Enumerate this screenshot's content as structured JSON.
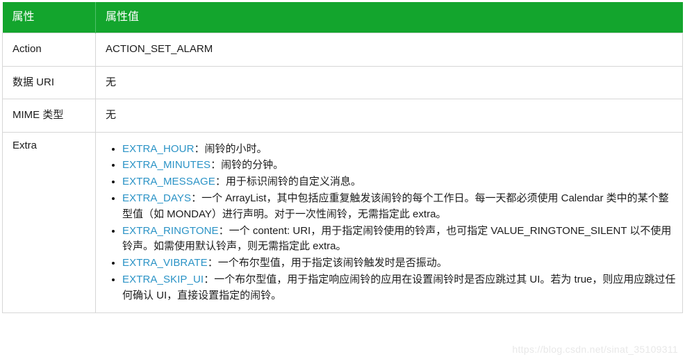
{
  "table": {
    "headers": [
      "属性",
      "属性值"
    ],
    "header_bg": "#13a52d",
    "link_color": "#2b93c6",
    "border_color": "#d6d6d6",
    "rows": [
      {
        "attr": "Action",
        "value": "ACTION_SET_ALARM"
      },
      {
        "attr": "数据 URI",
        "value": "无"
      },
      {
        "attr": "MIME 类型",
        "value": "无"
      }
    ],
    "extra_row": {
      "attr": "Extra",
      "items": [
        {
          "term": "EXTRA_HOUR",
          "text": "：闹铃的小时。"
        },
        {
          "term": "EXTRA_MINUTES",
          "text": "：闹铃的分钟。"
        },
        {
          "term": "EXTRA_MESSAGE",
          "text": "：用于标识闹铃的自定义消息。"
        },
        {
          "term": "EXTRA_DAYS",
          "text": "：一个 ArrayList，其中包括应重复触发该闹铃的每个工作日。每一天都必须使用 Calendar 类中的某个整型值（如 MONDAY）进行声明。对于一次性闹铃，无需指定此 extra。"
        },
        {
          "term": "EXTRA_RINGTONE",
          "text": "：一个 content: URI，用于指定闹铃使用的铃声，也可指定 VALUE_RINGTONE_SILENT 以不使用铃声。如需使用默认铃声，则无需指定此 extra。"
        },
        {
          "term": "EXTRA_VIBRATE",
          "text": "：一个布尔型值，用于指定该闹铃触发时是否振动。"
        },
        {
          "term": "EXTRA_SKIP_UI",
          "text": "：一个布尔型值，用于指定响应闹铃的应用在设置闹铃时是否应跳过其 UI。若为 true，则应用应跳过任何确认 UI，直接设置指定的闹铃。"
        }
      ]
    }
  },
  "watermark": {
    "text": "https://blog.csdn.net/sinat_35109311"
  }
}
